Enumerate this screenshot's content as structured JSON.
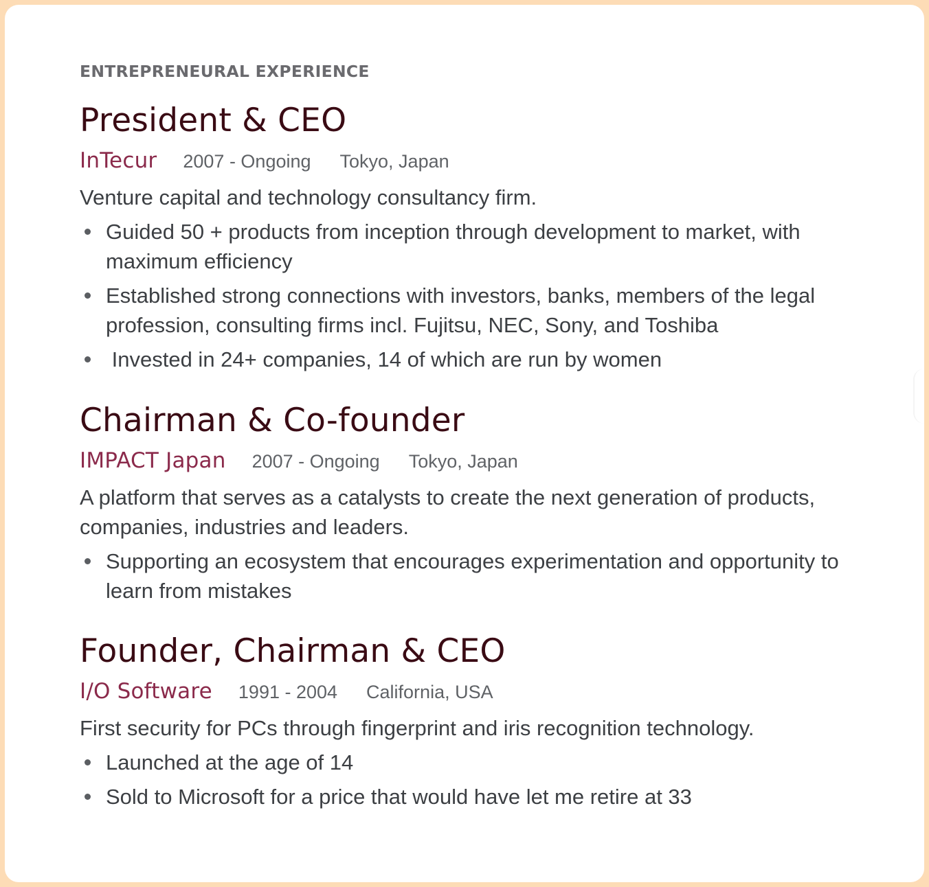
{
  "colors": {
    "border": "#fddcb6",
    "title": "#3a0b14",
    "company": "#8b2a4b",
    "meta": "#5f6266",
    "body": "#3c3f43",
    "heading": "#6a6a6e"
  },
  "section": {
    "heading": "ENTREPRENEURAL EXPERIENCE"
  },
  "entries": [
    {
      "title": "President & CEO",
      "company": "InTecur",
      "dates": "2007 - Ongoing",
      "location": "Tokyo, Japan",
      "description": "Venture capital and technology consultancy firm.",
      "bullets": [
        "Guided 50 + products from inception through development to market, with maximum efficiency",
        "Established strong connections with investors, banks, members of the legal profession, consulting firms incl. Fujitsu, NEC, Sony, and Toshiba",
        " Invested in 24+ companies, 14 of which are run by women"
      ]
    },
    {
      "title": "Chairman & Co-founder",
      "company": "IMPACT Japan",
      "dates": "2007 - Ongoing",
      "location": "Tokyo, Japan",
      "description": "A platform that serves as a catalysts to create the next generation of products, companies, industries and leaders.",
      "bullets": [
        "Supporting an ecosystem that encourages experimentation and opportunity to learn from mistakes"
      ]
    },
    {
      "title": "Founder, Chairman & CEO",
      "company": "I/O Software",
      "dates": "1991 - 2004",
      "location": "California, USA",
      "description": "First security for PCs through fingerprint and iris recognition technology.",
      "bullets": [
        "Launched at the age of 14",
        "Sold to Microsoft for a price that would have let me retire at 33"
      ]
    }
  ]
}
